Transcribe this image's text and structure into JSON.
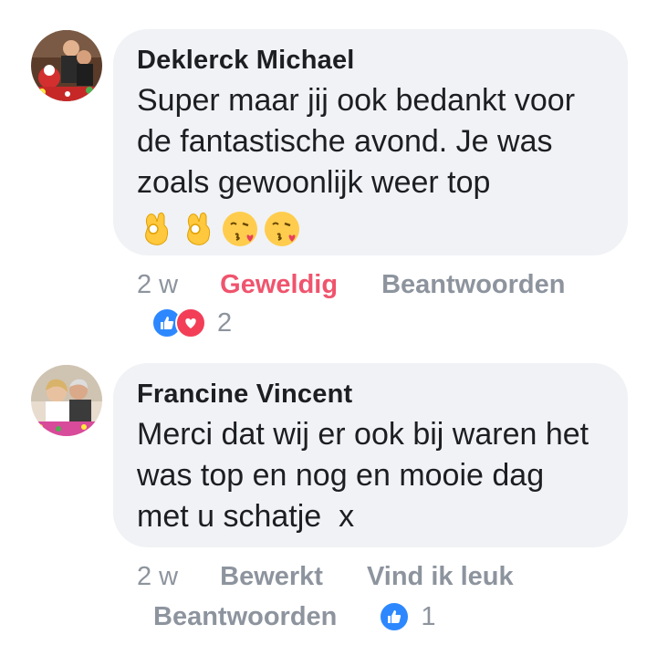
{
  "comments": [
    {
      "author": "Deklerck Michael",
      "text": "Super maar jij ook bedankt voor de fantastische avond. Je was zoals gewoonlijk weer top",
      "emojis": [
        "ok-hand-emoji",
        "ok-hand-emoji",
        "face-blowing-kiss-emoji",
        "face-blowing-kiss-emoji"
      ],
      "time": "2 w",
      "reaction_label": "Geweldig",
      "reply_label": "Beantwoorden",
      "reaction_count": "2",
      "reaction_icons": [
        "like-icon",
        "love-icon"
      ],
      "accent": "#f0546d"
    },
    {
      "author": "Francine Vincent",
      "text": "Merci dat wij er ook bij waren het was top en nog en mooie dag met u schatje  x",
      "time": "2 w",
      "edited_label": "Bewerkt",
      "like_label": "Vind ik leuk",
      "reply_label": "Beantwoorden",
      "reaction_count": "1",
      "reaction_icons": [
        "like-icon"
      ]
    }
  ],
  "colors": {
    "bubble": "#f0f2f5",
    "meta": "#8d949e",
    "like": "#2d88ff",
    "love": "#f33e58"
  }
}
